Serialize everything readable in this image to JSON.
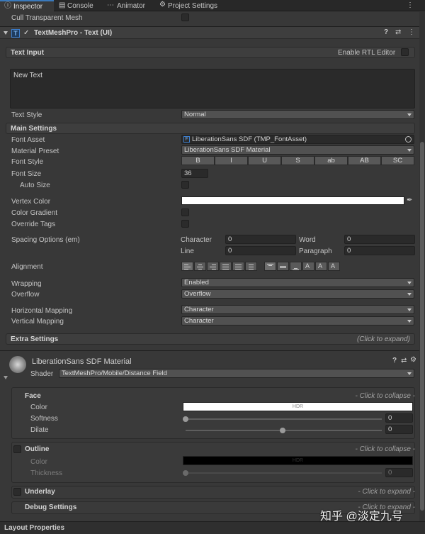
{
  "tabs": [
    {
      "label": "Inspector",
      "icon": "info-icon"
    },
    {
      "label": "Console",
      "icon": "console-icon"
    },
    {
      "label": "Animator",
      "icon": "animator-icon"
    },
    {
      "label": "Project Settings",
      "icon": "gear-icon"
    }
  ],
  "cull_transparent_mesh": "Cull Transparent Mesh",
  "component": {
    "title": "TextMeshPro - Text (UI)"
  },
  "text_input": {
    "header": "Text Input",
    "rtl_label": "Enable RTL Editor",
    "value": "New Text"
  },
  "text_style": {
    "label": "Text Style",
    "value": "Normal"
  },
  "main_settings": {
    "header": "Main Settings",
    "font_asset_label": "Font Asset",
    "font_asset_value": "LiberationSans SDF (TMP_FontAsset)",
    "material_preset_label": "Material Preset",
    "material_preset_value": "LiberationSans SDF Material",
    "font_style_label": "Font Style",
    "font_style_buttons": [
      "B",
      "I",
      "U",
      "S",
      "ab",
      "AB",
      "SC"
    ],
    "font_size_label": "Font Size",
    "font_size_value": "36",
    "auto_size_label": "Auto Size",
    "vertex_color_label": "Vertex Color",
    "color_gradient_label": "Color Gradient",
    "override_tags_label": "Override Tags",
    "spacing_label": "Spacing Options (em)",
    "character_label": "Character",
    "character_value": "0",
    "word_label": "Word",
    "word_value": "0",
    "line_label": "Line",
    "line_value": "0",
    "paragraph_label": "Paragraph",
    "paragraph_value": "0",
    "alignment_label": "Alignment",
    "wrapping_label": "Wrapping",
    "wrapping_value": "Enabled",
    "overflow_label": "Overflow",
    "overflow_value": "Overflow",
    "hmapping_label": "Horizontal Mapping",
    "hmapping_value": "Character",
    "vmapping_label": "Vertical Mapping",
    "vmapping_value": "Character"
  },
  "extra_settings": {
    "header": "Extra Settings",
    "hint": "(Click to expand)"
  },
  "material": {
    "title": "LiberationSans SDF Material",
    "shader_label": "Shader",
    "shader_value": "TextMeshPro/Mobile/Distance Field",
    "face": {
      "header": "Face",
      "hint": "- Click to collapse -",
      "color_label": "Color",
      "color_tag": "HDR",
      "softness_label": "Softness",
      "softness_value": "0",
      "softness_level": 0,
      "dilate_label": "Dilate",
      "dilate_value": "0",
      "dilate_level": 0.5
    },
    "outline": {
      "header": "Outline",
      "hint": "- Click to collapse -",
      "color_label": "Color",
      "color_tag": "HDR",
      "thickness_label": "Thickness",
      "thickness_value": "0",
      "thickness_level": 0
    },
    "underlay": {
      "header": "Underlay",
      "hint": "- Click to expand -"
    },
    "debug": {
      "header": "Debug Settings",
      "hint": "- Click to expand -"
    }
  },
  "layout_properties": "Layout Properties",
  "watermark": "知乎 @淡定九号",
  "colors": {
    "panel": "#383838",
    "field": "#2a2a2a",
    "dropdown": "#515151",
    "face_color": "#ffffff",
    "outline_color": "#000000",
    "component_icon": "#3c7fd0"
  }
}
